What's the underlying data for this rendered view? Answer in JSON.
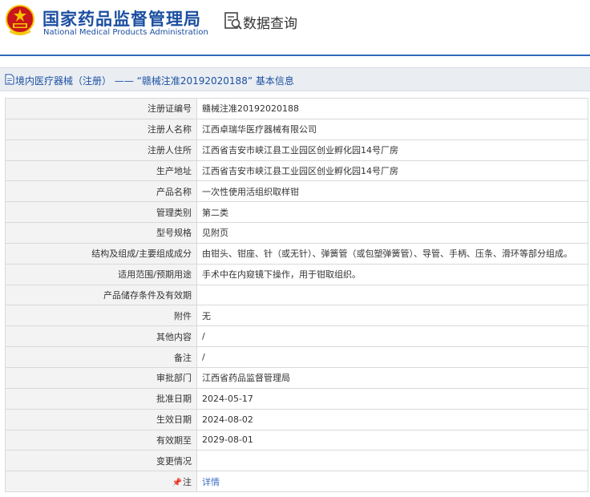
{
  "header": {
    "org_name_cn": "国家药品监督管理局",
    "org_name_en": "National Medical Products Administration",
    "query_label": "数据查询",
    "emblem_icon": "national-emblem-icon",
    "query_icon": "data-query-icon"
  },
  "title_bar": {
    "text": "境内医疗器械（注册） —— “赣械注准20192020188” 基本信息",
    "icon": "document-icon"
  },
  "rows": [
    {
      "label": "注册证编号",
      "value": "赣械注准20192020188"
    },
    {
      "label": "注册人名称",
      "value": "江西卓瑞华医疗器械有限公司"
    },
    {
      "label": "注册人住所",
      "value": "江西省吉安市峡江县工业园区创业孵化园14号厂房"
    },
    {
      "label": "生产地址",
      "value": "江西省吉安市峡江县工业园区创业孵化园14号厂房"
    },
    {
      "label": "产品名称",
      "value": "一次性使用活组织取样钳"
    },
    {
      "label": "管理类别",
      "value": "第二类"
    },
    {
      "label": "型号规格",
      "value": "见附页"
    },
    {
      "label": "结构及组成/主要组成成分",
      "value": "由钳头、钳座、针（或无针）、弹簧管（或包塑弹簧管）、导管、手柄、压条、滑环等部分组成。"
    },
    {
      "label": "适用范围/预期用途",
      "value": "手术中在内窥镜下操作，用于钳取组织。"
    },
    {
      "label": "产品储存条件及有效期",
      "value": ""
    },
    {
      "label": "附件",
      "value": "无"
    },
    {
      "label": "其他内容",
      "value": "/"
    },
    {
      "label": "备注",
      "value": "/"
    },
    {
      "label": "审批部门",
      "value": "江西省药品监督管理局"
    },
    {
      "label": "批准日期",
      "value": "2024-05-17"
    },
    {
      "label": "生效日期",
      "value": "2024-08-02"
    },
    {
      "label": "有效期至",
      "value": "2029-08-01"
    },
    {
      "label": "变更情况",
      "value": ""
    }
  ],
  "note_row": {
    "pin_icon": "pin-icon",
    "label": "注",
    "link_text": "详情"
  },
  "colors": {
    "brand_blue": "#1c4fa0",
    "header_line": "#2f6ab8",
    "link": "#3a6fc4",
    "label_bg": "#f3f3f3",
    "title_bar_bg": "#eaeef3",
    "emblem_red": "#c8161d",
    "emblem_gold": "#f5c400"
  }
}
